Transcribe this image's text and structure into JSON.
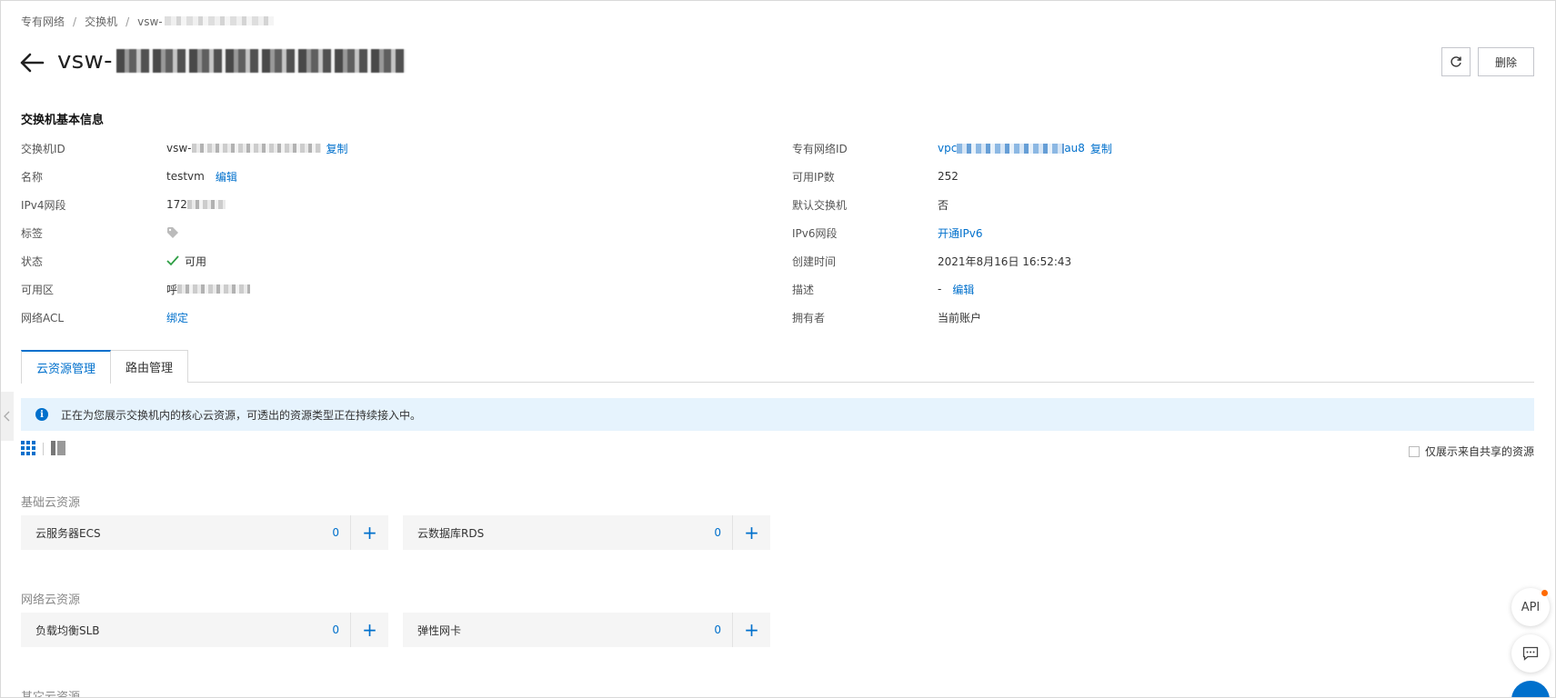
{
  "breadcrumb": {
    "items": [
      "专有网络",
      "交换机",
      "vsw-"
    ],
    "separator": "/"
  },
  "header": {
    "title_prefix": "vsw-",
    "delete_label": "删除"
  },
  "section": {
    "title": "交换机基本信息"
  },
  "left_info": [
    {
      "label": "交换机ID",
      "value": "vsw-",
      "action": "复制"
    },
    {
      "label": "名称",
      "value": "testvm",
      "action": "编辑"
    },
    {
      "label": "IPv4网段",
      "value": "172"
    },
    {
      "label": "标签",
      "value": ""
    },
    {
      "label": "状态",
      "value": "可用"
    },
    {
      "label": "可用区",
      "value": "呼"
    },
    {
      "label": "网络ACL",
      "value": "",
      "action": "绑定"
    }
  ],
  "right_info": [
    {
      "label": "专有网络ID",
      "value": "vpc",
      "value_suffix": "au8",
      "action": "复制"
    },
    {
      "label": "可用IP数",
      "value": "252"
    },
    {
      "label": "默认交换机",
      "value": "否"
    },
    {
      "label": "IPv6网段",
      "value": "",
      "action": "开通IPv6"
    },
    {
      "label": "创建时间",
      "value": "2021年8月16日 16:52:43"
    },
    {
      "label": "描述",
      "value": "-",
      "action": "编辑"
    },
    {
      "label": "拥有者",
      "value": "当前账户"
    }
  ],
  "tabs": [
    {
      "label": "云资源管理",
      "active": true
    },
    {
      "label": "路由管理",
      "active": false
    }
  ],
  "notice": {
    "text": "正在为您展示交换机内的核心云资源，可透出的资源类型正在持续接入中。"
  },
  "shared_only": {
    "label": "仅展示来自共享的资源",
    "checked": false
  },
  "groups": [
    {
      "title": "基础云资源",
      "cards": [
        {
          "name": "云服务器ECS",
          "count": "0"
        },
        {
          "name": "云数据库RDS",
          "count": "0"
        }
      ]
    },
    {
      "title": "网络云资源",
      "cards": [
        {
          "name": "负载均衡SLB",
          "count": "0"
        },
        {
          "name": "弹性网卡",
          "count": "0"
        }
      ]
    },
    {
      "title": "其它云资源"
    }
  ],
  "float": {
    "api_label": "API"
  },
  "colors": {
    "link": "#0070cc",
    "notice_bg": "#e6f3fd",
    "status_ok": "#2e9e44",
    "api_dot": "#ff6a00"
  },
  "icons": [
    "back-arrow-icon",
    "refresh-icon",
    "tag-icon",
    "check-icon",
    "info-icon",
    "grid-view-icon",
    "list-view-icon",
    "plus-icon",
    "chat-icon",
    "collapse-chevron-icon"
  ]
}
